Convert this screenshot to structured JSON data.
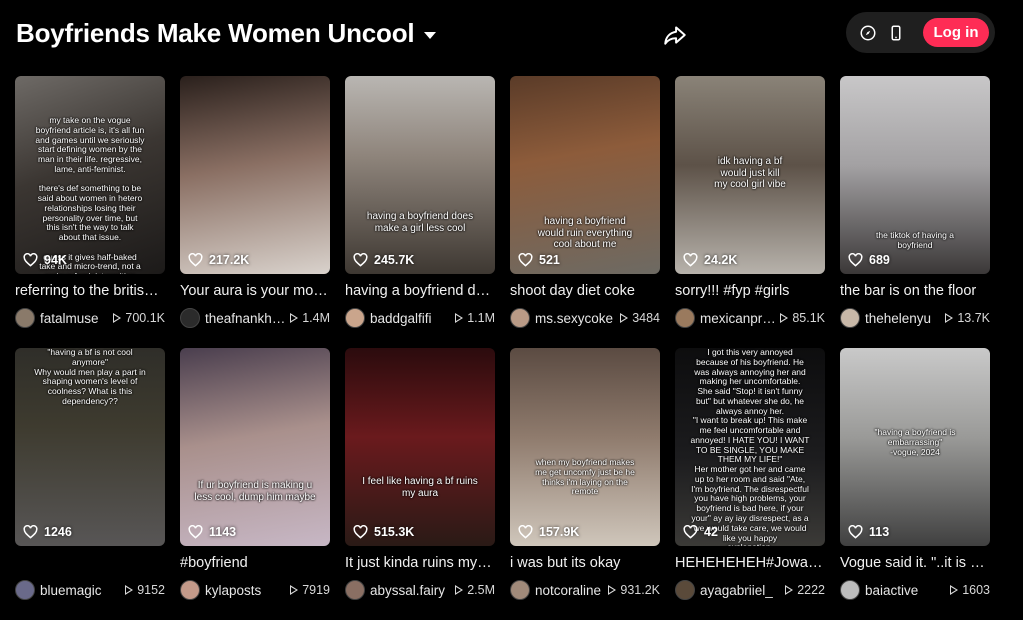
{
  "header": {
    "title": "Boyfriends Make Women Uncool",
    "login_label": "Log in"
  },
  "icons": {
    "title_dropdown": "chevron-down-icon",
    "share": "share-icon",
    "compass": "compass-icon",
    "mobile": "mobile-icon",
    "like": "heart-icon",
    "views": "play-icon"
  },
  "colors": {
    "background": "#000000",
    "accent": "#fe2c55",
    "pill": "#1f1f1f"
  },
  "videos": [
    {
      "likes": "94K",
      "caption": "referring to the british vogue article",
      "author": "fatalmuse",
      "views": "700.1K",
      "overlay": "my take on the vogue\nboyfriend article is, it's all fun\nand games until we seriously\nstart defining women by the\nman in their life. regressive,\nlame, anti-feminist.\n\nthere's def something to be\nsaid about women in hetero\nrelationships losing their\npersonality over time, but\nthis isn't the way to talk\nabout that issue.\n\nguess it gives half-baked\ntake and micro-trend, not a\nserious feminist position"
    },
    {
      "likes": "217.2K",
      "caption": "Your aura is your most important asset",
      "author": "theafnankhan",
      "views": "1.4M",
      "overlay": ""
    },
    {
      "likes": "245.7K",
      "caption": "having a boyfriend does make a girl less cool",
      "author": "baddgalfifi",
      "views": "1.1M",
      "overlay": "having a boyfriend does\nmake a girl less cool"
    },
    {
      "likes": "521",
      "caption": "shoot day diet coke",
      "author": "ms.sexycoke",
      "views": "3484",
      "overlay": "having a boyfriend\nwould ruin everything\ncool about me"
    },
    {
      "likes": "24.2K",
      "caption": "sorry!!! #fyp #girls",
      "author": "mexicanprincess",
      "views": "85.1K",
      "overlay": "idk having a bf\nwould just kill\nmy cool girl vibe"
    },
    {
      "likes": "689",
      "caption": "the bar is on the floor",
      "author": "thehelenyu",
      "views": "13.7K",
      "overlay": "the tiktok of having a\nboyfriend"
    },
    {
      "likes": "1246",
      "caption": "",
      "author": "bluemagic",
      "views": "9152",
      "overlay": "\"having a bf is not cool\nanymore\"\nWhy would men play a part in\nshaping women's level of\ncoolness? What is this\ndependency??"
    },
    {
      "likes": "1143",
      "caption": "#boyfriend",
      "author": "kylaposts",
      "views": "7919",
      "overlay": "If ur boyfriend is making u\nless cool, dump him maybe"
    },
    {
      "likes": "515.3K",
      "caption": "It just kinda ruins my aura",
      "author": "abyssal.fairy",
      "views": "2.5M",
      "overlay": "I feel like having a bf ruins\nmy aura"
    },
    {
      "likes": "157.9K",
      "caption": "i was but its okay",
      "author": "notcoraline",
      "views": "931.2K",
      "overlay": "when my boyfriend makes\nme get uncomfy just be he\nthinks i'm laying on the\nremote"
    },
    {
      "likes": "42",
      "caption": "HEHEHEHEH#JowaSerye",
      "author": "ayagabriiel_",
      "views": "2222",
      "overlay": "I got this very annoyed\nbecause of his boyfriend. He\nwas always annoying her and\nmaking her uncomfortable.\nShe said \"Stop! it isn't funny\nbut\" but whatever she do, he\nalways annoy her.\n\"I want to break up! This make\nme feel uncomfortable and\nannoyed! I HATE YOU! I WANT\nTO BE SINGLE, YOU MAKE\nTHEM MY LIFE!\"\nHer mother got her and came\nup to her room and said \"Ate,\nI'm boyfriend. The disrespectful\nyou have high problems, your\nboyfriend is bad here, if your\nyour\" ay ay iay disrespect, as a\nwe would take care, we would\nlike you happy\nexplanation."
    },
    {
      "likes": "113",
      "caption": "Vogue said it. \"..it is embarrassing\"",
      "author": "baiactive",
      "views": "1603",
      "overlay": "\"having a boyfriend is\nembarrassing\"\n-vogue, 2024"
    }
  ]
}
